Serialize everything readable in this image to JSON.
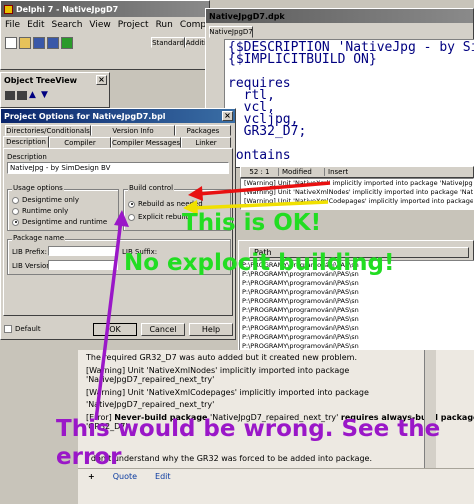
{
  "delphi": {
    "title": "Delphi 7 - NativeJpgD7",
    "menu": [
      "File",
      "Edit",
      "Search",
      "View",
      "Project",
      "Run",
      "Compon"
    ],
    "palette_tabs": [
      "Standard",
      "Additio"
    ]
  },
  "tree_view": {
    "title": "Object TreeView"
  },
  "editor": {
    "title": "NativeJpgD7.dpk",
    "tab": "NativeJpgD7",
    "lines": [
      "{$DESCRIPTION 'NativeJpg - by Sim",
      "{$IMPLICITBUILD ON}",
      "",
      "requires",
      "  rtl,",
      "  vcl,",
      "  vcljpg,",
      "  GR32_D7;",
      "",
      "contains"
    ],
    "status": {
      "pos": "52 : 1",
      "state": "Modified",
      "mode": "Insert"
    },
    "messages": [
      "[Warning] Unit 'NativeXml' implicitly imported into package 'NativeJpgD7'",
      "[Warning] Unit 'NativeXmlNodes' implicitly imported into package 'NativeJpgD7'",
      "[Warning] Unit 'NativeXmlCodepages' implicitly imported into package 'NativeJpgD7'"
    ],
    "path_header": "Path",
    "paths": [
      "P:\\PROGRAMY\\programování\\PAS\\sn",
      "P:\\PROGRAMY\\programování\\PAS\\sn",
      "P:\\PROGRAMY\\programování\\PAS\\sn",
      "P:\\PROGRAMY\\programování\\PAS\\sn",
      "P:\\PROGRAMY\\programování\\PAS\\sn",
      "P:\\PROGRAMY\\programování\\PAS\\sn",
      "P:\\PROGRAMY\\programování\\PAS\\sn",
      "P:\\PROGRAMY\\programování\\PAS\\sn",
      "P:\\PROGRAMY\\programování\\PAS\\sn",
      "P:\\PROGRAMY\\programování\\PAS\\sn"
    ]
  },
  "options": {
    "title": "Project Options for NativeJpgD7.bpl",
    "tabs_row1": [
      "Directories/Conditionals",
      "Version Info",
      "Packages"
    ],
    "tabs_row2": [
      "Description",
      "Compiler",
      "Compiler Messages",
      "Linker"
    ],
    "description_label": "Description",
    "description_value": "NativeJpg - by SimDesign BV",
    "usage_label": "Usage options",
    "usage": [
      "Designtime only",
      "Runtime only",
      "Designtime and runtime"
    ],
    "build_label": "Build control",
    "build": [
      "Rebuild as needed",
      "Explicit rebuild"
    ],
    "package_name_label": "Package name",
    "lib_prefix": "LIB Prefix:",
    "lib_suffix": "LIB Suffix:",
    "lib_version": "LIB Version:",
    "default_label": "Default",
    "ok": "OK",
    "cancel": "Cancel",
    "help": "Help"
  },
  "lower": {
    "lines": [
      "The required GR32_D7 was auto added but it created new problem.",
      "[Warning] Unit 'NativeXmlNodes' implicitly imported into package",
      "'NativeJpgD7_repaired_next_try'",
      "[Warning] Unit 'NativeXmlCodepages' implicitly imported into package",
      "'NativeJpgD7_repaired_next_try'"
    ],
    "error_prefix": "[Error] ",
    "error_b1": "Never-build package",
    "error_m1": " 'NativeJpgD7_repaired_next_try' ",
    "error_b2": "requires always-build package",
    "error_line2": "'GR32_D7'",
    "last_line": "I don't understand why the GR32 was forced to be added into package.",
    "buttons": [
      "+",
      "Quote",
      "Edit"
    ]
  },
  "annotations": {
    "ok_text": "This is OK!",
    "no_build": "No explocit building!",
    "wrong_line1": "This would be wrong. See the",
    "wrong_line2": "error",
    "colors": {
      "red": "#e81010",
      "yellow": "#f0e000",
      "green": "#22dd22",
      "purple": "#9a17c8"
    }
  }
}
